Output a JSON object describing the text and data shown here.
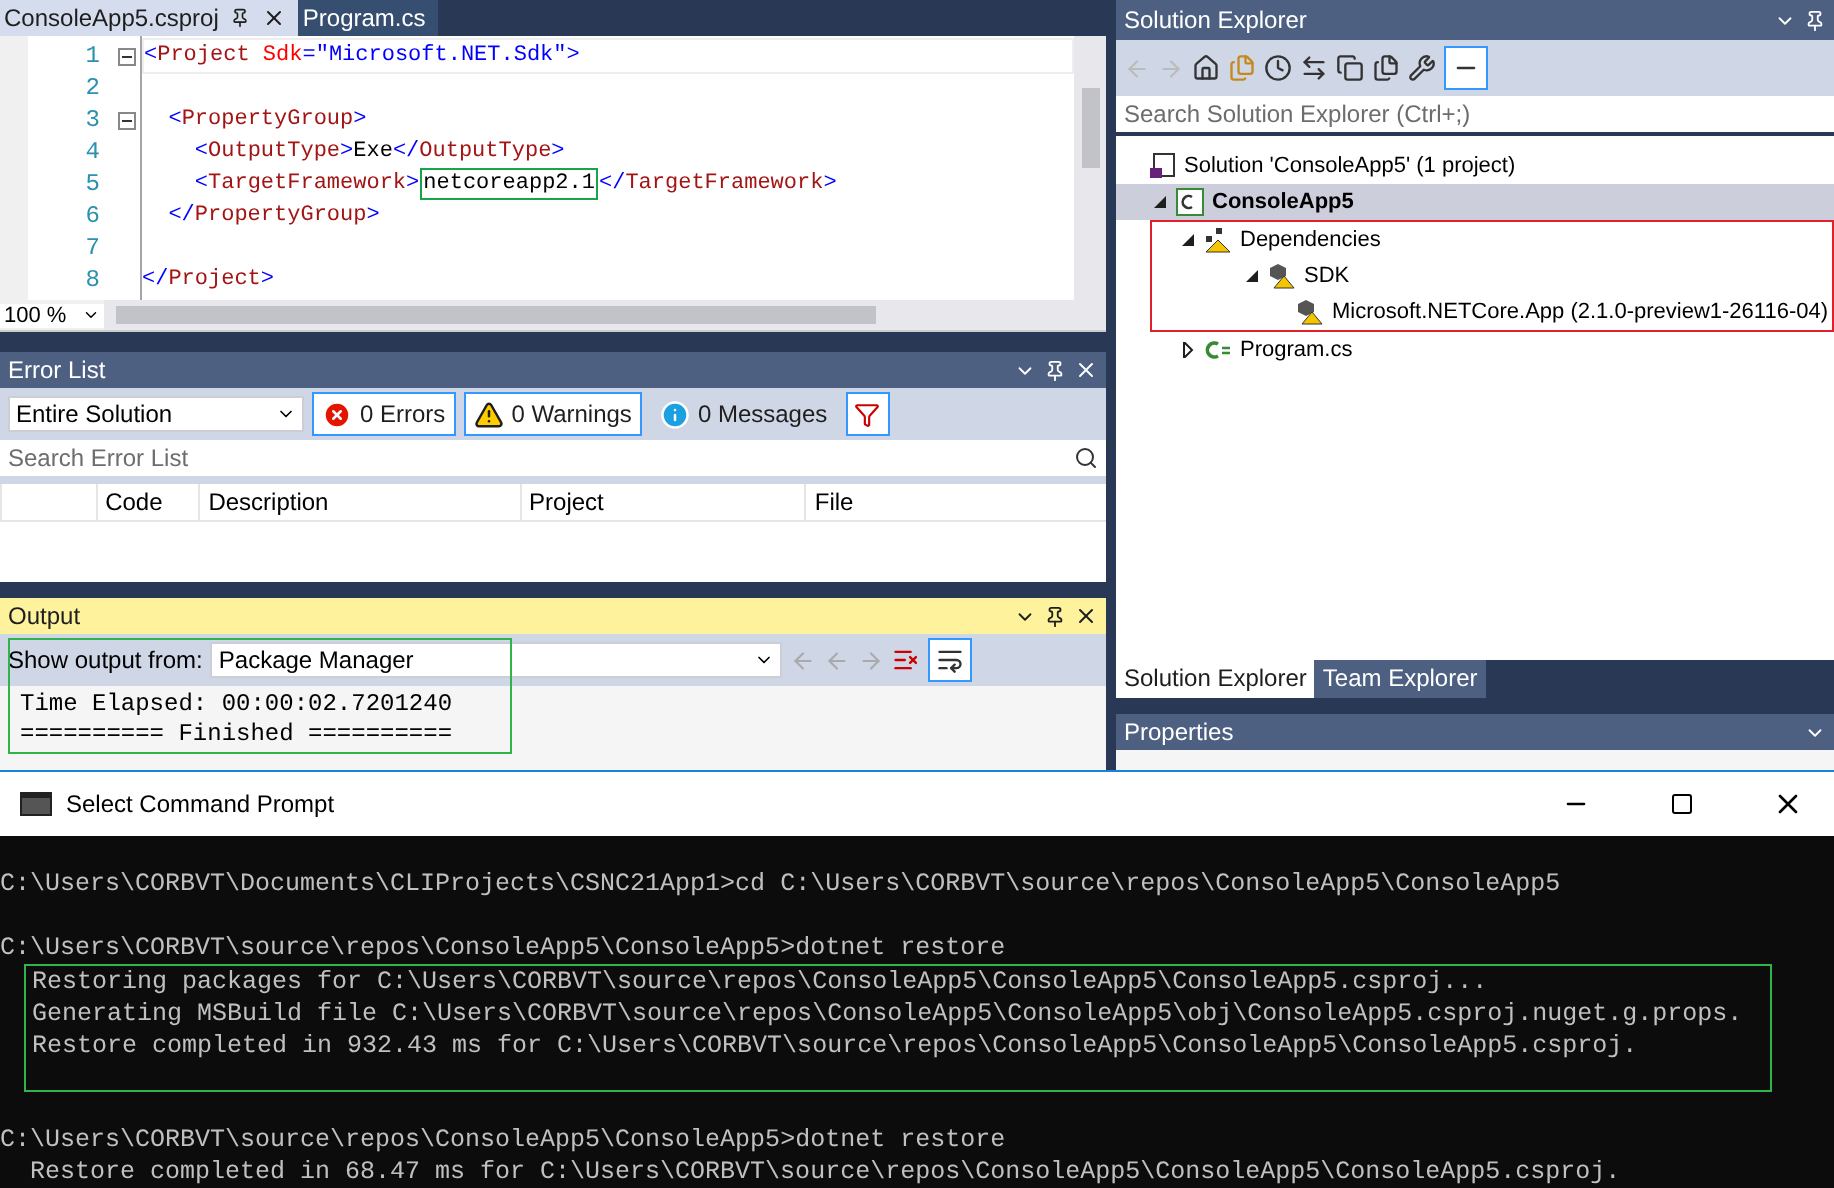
{
  "editor": {
    "tabs": [
      {
        "label": "ConsoleApp5.csproj",
        "selected": true
      },
      {
        "label": "Program.cs",
        "selected": false
      }
    ],
    "lines": [
      {
        "number": "1",
        "fold": true,
        "tokens": [
          {
            "kind": "bracket",
            "text": "<"
          },
          {
            "kind": "name",
            "text": "Project"
          },
          {
            "kind": "attr",
            "text": " Sdk"
          },
          {
            "kind": "bracket",
            "text": "="
          },
          {
            "kind": "value",
            "text": "\"Microsoft.NET.Sdk\""
          },
          {
            "kind": "bracket",
            "text": ">"
          }
        ]
      },
      {
        "number": "2",
        "fold": false
      },
      {
        "number": "3",
        "fold": true,
        "tokens": [
          {
            "kind": "bracket",
            "text": "  <"
          },
          {
            "kind": "name",
            "text": "PropertyGroup"
          },
          {
            "kind": "bracket",
            "text": ">"
          }
        ]
      },
      {
        "number": "4",
        "fold": false,
        "tokens": [
          {
            "kind": "bracket",
            "text": "    <"
          },
          {
            "kind": "name",
            "text": "OutputType"
          },
          {
            "kind": "bracket",
            "text": ">"
          },
          {
            "kind": "text",
            "text": "Exe"
          },
          {
            "kind": "bracket",
            "text": "</"
          },
          {
            "kind": "name",
            "text": "OutputType"
          },
          {
            "kind": "bracket",
            "text": ">"
          }
        ]
      },
      {
        "number": "5",
        "fold": false,
        "tokens": [
          {
            "kind": "bracket",
            "text": "    <",
            "boxed": false
          },
          {
            "kind": "name",
            "text": "TargetFramework",
            "boxed": false
          },
          {
            "kind": "bracket",
            "text": ">",
            "boxed": false
          },
          {
            "kind": "text",
            "text": "netcoreapp2.1",
            "boxed": true
          },
          {
            "kind": "bracket",
            "text": "</",
            "boxed": false
          },
          {
            "kind": "name",
            "text": "TargetFramework",
            "boxed": false
          },
          {
            "kind": "bracket",
            "text": ">",
            "boxed": false
          }
        ]
      },
      {
        "number": "6",
        "fold": false,
        "tokens": [
          {
            "kind": "bracket",
            "text": "  </"
          },
          {
            "kind": "name",
            "text": "PropertyGroup"
          },
          {
            "kind": "bracket",
            "text": ">"
          }
        ]
      },
      {
        "number": "7",
        "fold": false
      },
      {
        "number": "8",
        "fold": false,
        "tokens": [
          {
            "kind": "bracket",
            "text": "</"
          },
          {
            "kind": "name",
            "text": "Project"
          },
          {
            "kind": "bracket",
            "text": ">"
          }
        ]
      }
    ],
    "zoom": "100 %"
  },
  "error_list": {
    "title": "Error List",
    "scope": "Entire Solution",
    "filters": [
      {
        "kind": "error",
        "label": "0 Errors",
        "selected": true
      },
      {
        "kind": "warning",
        "label": "0 Warnings",
        "selected": true
      },
      {
        "kind": "info",
        "label": "0 Messages",
        "selected": false
      }
    ],
    "search": {
      "placeholder": "Search Error List"
    },
    "columns": [
      "Code",
      "Description",
      "Project",
      "File"
    ]
  },
  "output": {
    "title": "Output",
    "active": true,
    "source_label": "Show output from:",
    "source": "Package Manager",
    "lines": [
      "Time Elapsed: 00:00:02.7201240",
      "========== Finished =========="
    ]
  },
  "solution_explorer": {
    "title": "Solution Explorer",
    "search": {
      "placeholder": "Search Solution Explorer (Ctrl+;)"
    },
    "tree": [
      {
        "kind": "solution",
        "label": "Solution 'ConsoleApp5' (1 project)",
        "selected": false,
        "children": [
          {
            "kind": "project",
            "label": "ConsoleApp5",
            "selected": true,
            "expanded": true,
            "children": [
              {
                "kind": "dependencies",
                "label": "Dependencies",
                "selected": false,
                "expanded": true,
                "flagged": true,
                "children": [
                  {
                    "kind": "sdk",
                    "label": "SDK",
                    "selected": false,
                    "expanded": true,
                    "children": [
                      {
                        "kind": "package",
                        "label": "Microsoft.NETCore.App (2.1.0-preview1-26116-04)",
                        "selected": false
                      }
                    ]
                  }
                ]
              },
              {
                "kind": "csfile",
                "label": "Program.cs",
                "selected": false,
                "expanded": false
              }
            ]
          }
        ]
      }
    ],
    "tabs": [
      {
        "label": "Solution Explorer",
        "selected": true
      },
      {
        "label": "Team Explorer",
        "selected": false
      }
    ]
  },
  "properties": {
    "title": "Properties"
  },
  "command_prompt": {
    "title": "Select Command Prompt",
    "lines": [
      {
        "kind": "command",
        "text": "C:\\Users\\CORBVT\\Documents\\CLIProjects\\CSNC21App1>cd C:\\Users\\CORBVT\\source\\repos\\ConsoleApp5\\ConsoleApp5",
        "framed": false
      },
      {
        "kind": "command",
        "text": "C:\\Users\\CORBVT\\source\\repos\\ConsoleApp5\\ConsoleApp5>dotnet restore",
        "framed": false
      },
      {
        "kind": "output",
        "text": "Restoring packages for C:\\Users\\CORBVT\\source\\repos\\ConsoleApp5\\ConsoleApp5\\ConsoleApp5.csproj...",
        "framed": true
      },
      {
        "kind": "output",
        "text": "Generating MSBuild file C:\\Users\\CORBVT\\source\\repos\\ConsoleApp5\\ConsoleApp5\\obj\\ConsoleApp5.csproj.nuget.g.props.",
        "framed": true
      },
      {
        "kind": "output",
        "text": "Restore completed in 932.43 ms for C:\\Users\\CORBVT\\source\\repos\\ConsoleApp5\\ConsoleApp5\\ConsoleApp5.csproj.",
        "framed": true
      },
      {
        "kind": "command",
        "text": "C:\\Users\\CORBVT\\source\\repos\\ConsoleApp5\\ConsoleApp5>dotnet restore",
        "framed": false
      },
      {
        "kind": "output",
        "text": "Restore completed in 68.47 ms for C:\\Users\\CORBVT\\source\\repos\\ConsoleApp5\\ConsoleApp5\\ConsoleApp5.csproj.",
        "framed": false
      }
    ]
  }
}
